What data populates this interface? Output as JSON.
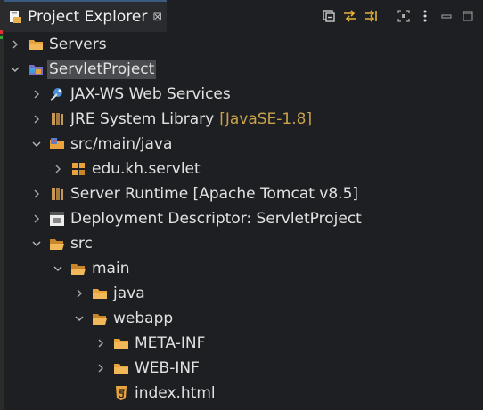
{
  "view": {
    "title": "Project Explorer",
    "close_glyph": "⊠"
  },
  "toolbar": {
    "icons": [
      "collapse-all-icon",
      "link-with-editor-icon",
      "filter-icon",
      "focus-icon",
      "view-menu-icon",
      "minimize-icon",
      "maximize-icon"
    ]
  },
  "tree": {
    "servers": "Servers",
    "project": "ServletProject",
    "jaxws": "JAX-WS Web Services",
    "jre": "JRE System Library",
    "jre_decoration": "[JavaSE-1.8]",
    "src_main_java": "src/main/java",
    "package": "edu.kh.servlet",
    "server_runtime": "Server Runtime [Apache Tomcat v8.5]",
    "deployment": "Deployment Descriptor: ServletProject",
    "src": "src",
    "main": "main",
    "java": "java",
    "webapp": "webapp",
    "meta_inf": "META-INF",
    "web_inf": "WEB-INF",
    "index": "index.html"
  },
  "colors": {
    "background": "#1e1f22",
    "folder": "#e8a33d",
    "selection": "#4a4b4f",
    "decoration": "#c9a24a"
  }
}
